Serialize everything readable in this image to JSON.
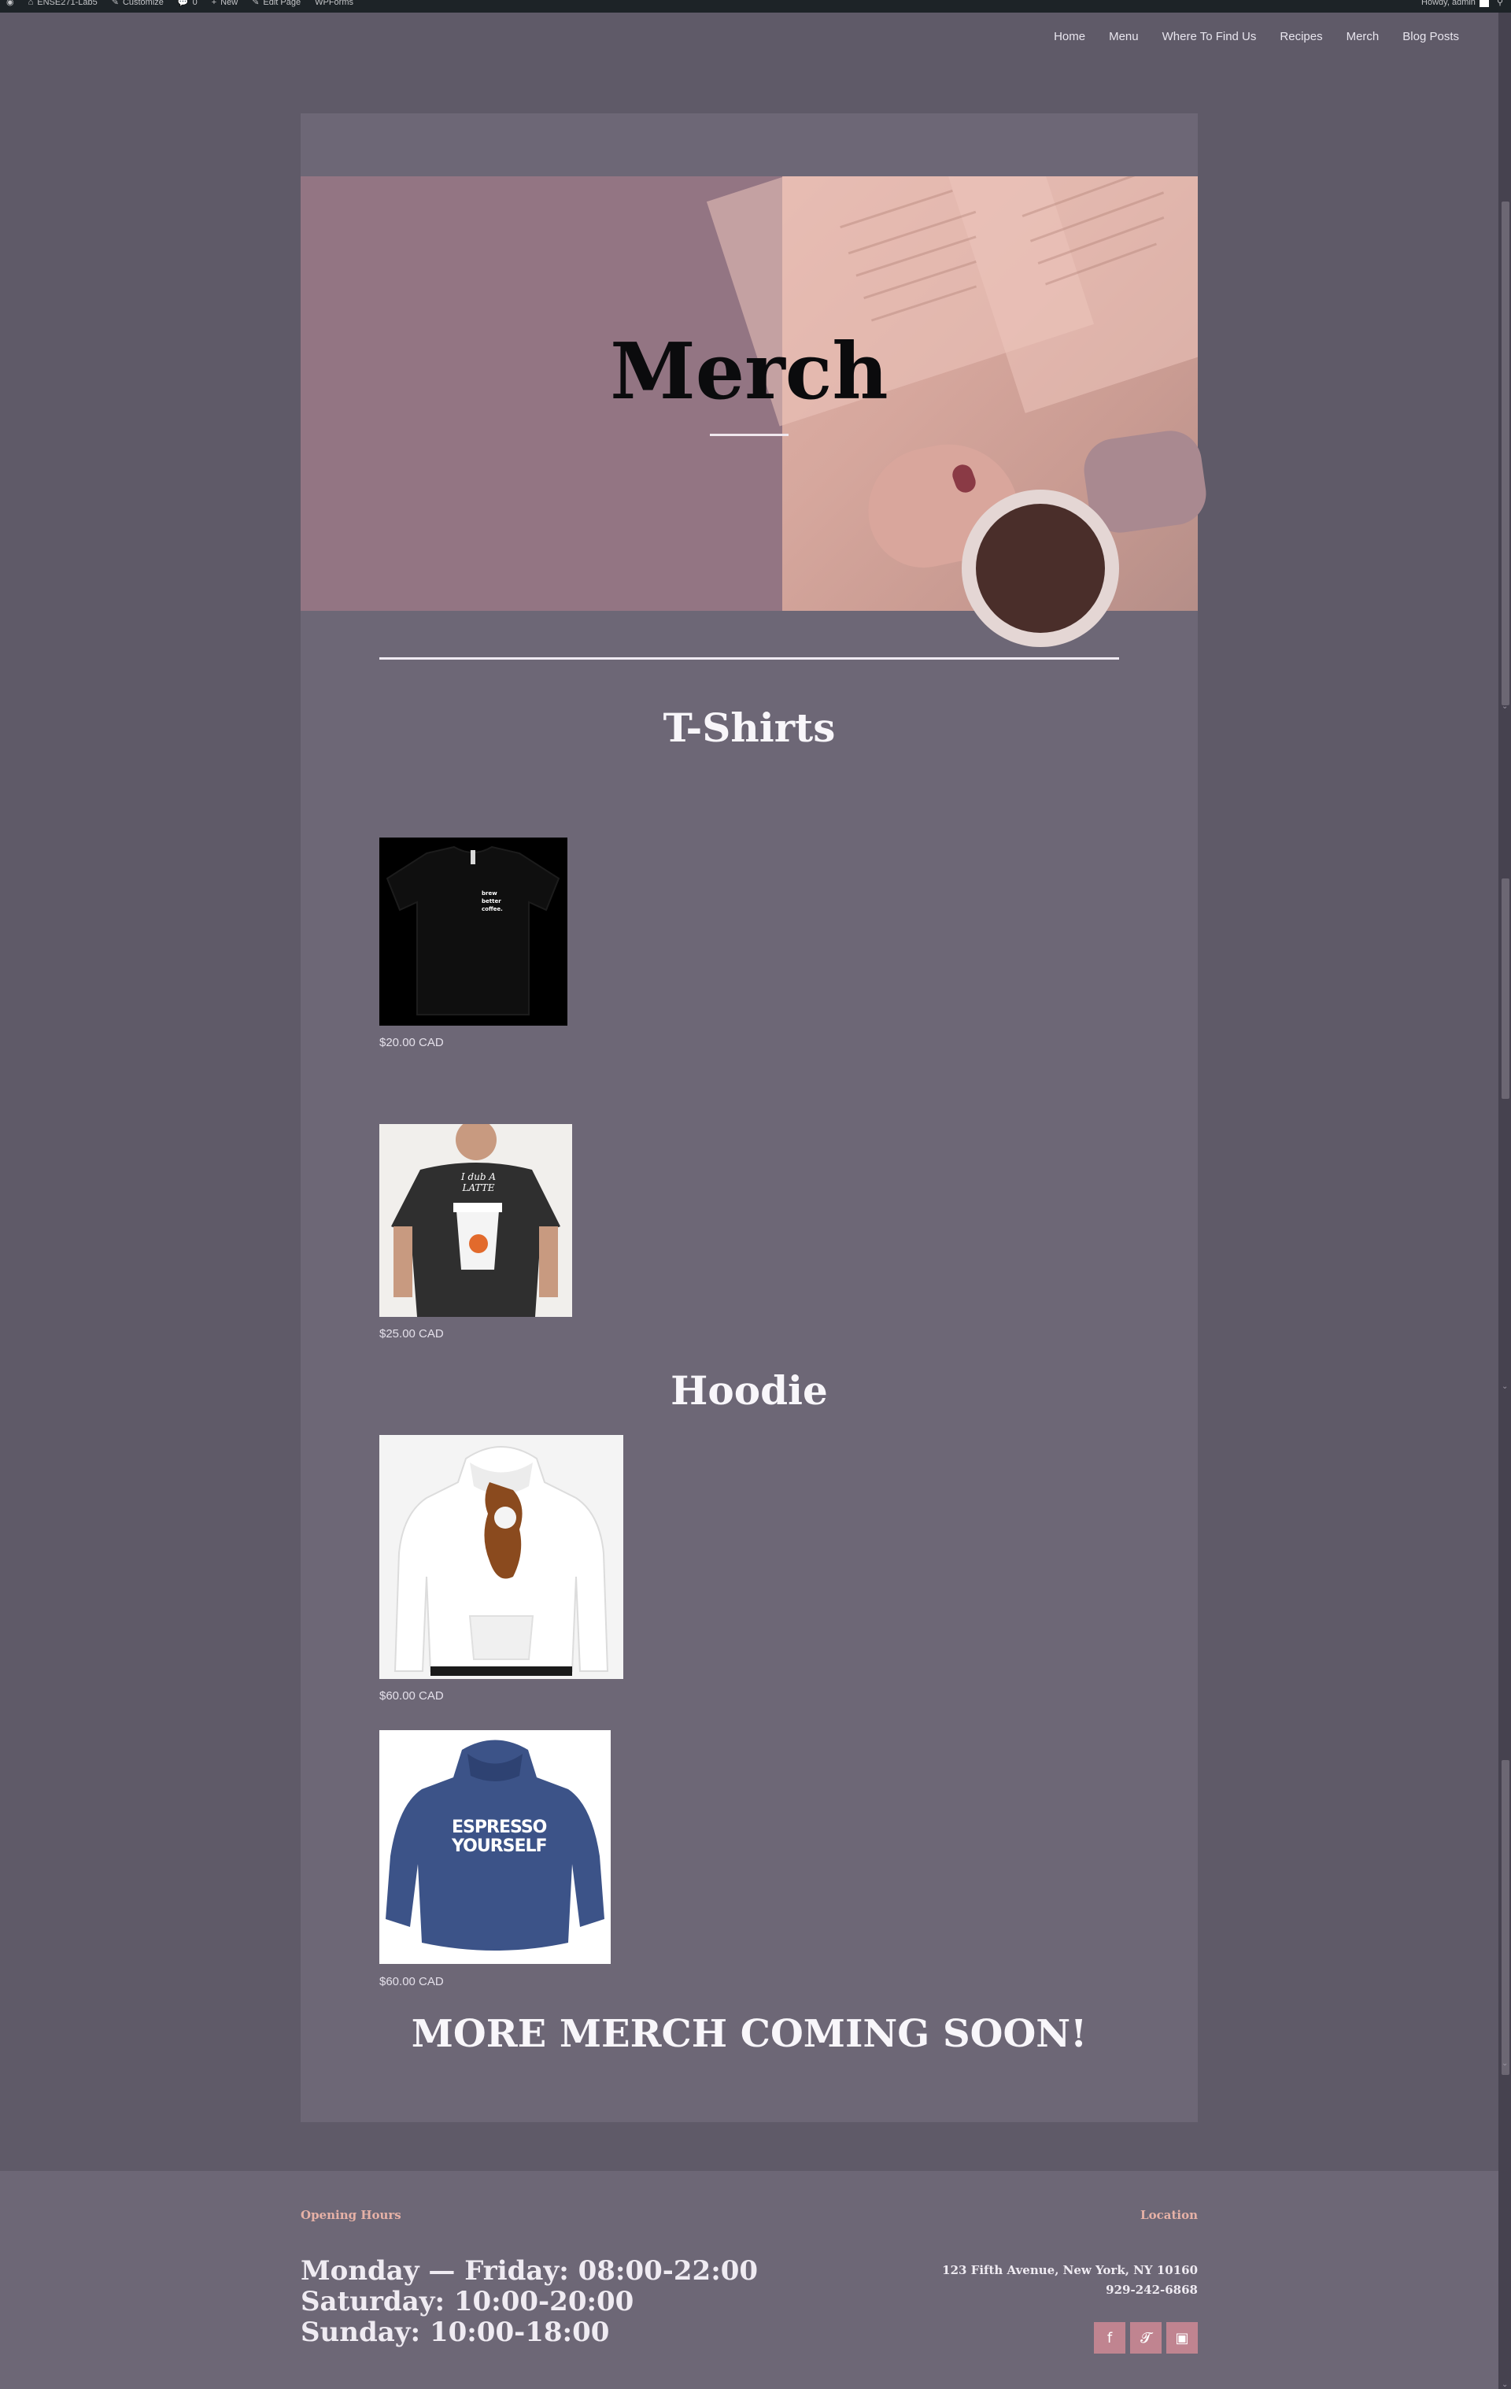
{
  "admin_bar": {
    "items": [
      "ENSE271-Lab5",
      "Customize",
      "0",
      "New",
      "Edit Page",
      "WPForms"
    ],
    "howdy": "Howdy, admin"
  },
  "nav": {
    "items": [
      "Home",
      "Menu",
      "Where To Find Us",
      "Recipes",
      "Merch",
      "Blog Posts"
    ]
  },
  "hero": {
    "title": "Merch"
  },
  "sections": {
    "tshirts": {
      "title": "T-Shirts"
    },
    "hoodie": {
      "title": "Hoodie"
    }
  },
  "products": [
    {
      "name": "brew-better-coffee-tshirt",
      "shirt_text": "brew better coffee.",
      "price": "$20.00 CAD"
    },
    {
      "name": "i-dub-a-latte-tshirt",
      "shirt_text": "I dub A LATTE",
      "price": "$25.00 CAD"
    },
    {
      "name": "white-hoodie",
      "price": "$60.00 CAD"
    },
    {
      "name": "espresso-yourself-hoodie",
      "hoodie_text": "ESPRESSO YOURSELF",
      "price": "$60.00 CAD"
    }
  ],
  "coming_soon": "MORE MERCH COMING SOON!",
  "footer": {
    "hours_heading": "Opening Hours",
    "hours": [
      "Monday — Friday: 08:00-22:00",
      "Saturday: 10:00-20:00",
      "Sunday: 10:00-18:00"
    ],
    "location_heading": "Location",
    "address": "123 Fifth Avenue, New York, NY 10160",
    "phone": "929-242-6868",
    "social_icons": [
      "facebook-icon",
      "twitter-icon",
      "instagram-icon"
    ]
  },
  "colors": {
    "page_bg": "#5f5a68",
    "card_bg": "#6d6776",
    "hero_mauve": "#937583",
    "accent_pink": "#c08490",
    "footer_heading": "#e6b1a6"
  }
}
